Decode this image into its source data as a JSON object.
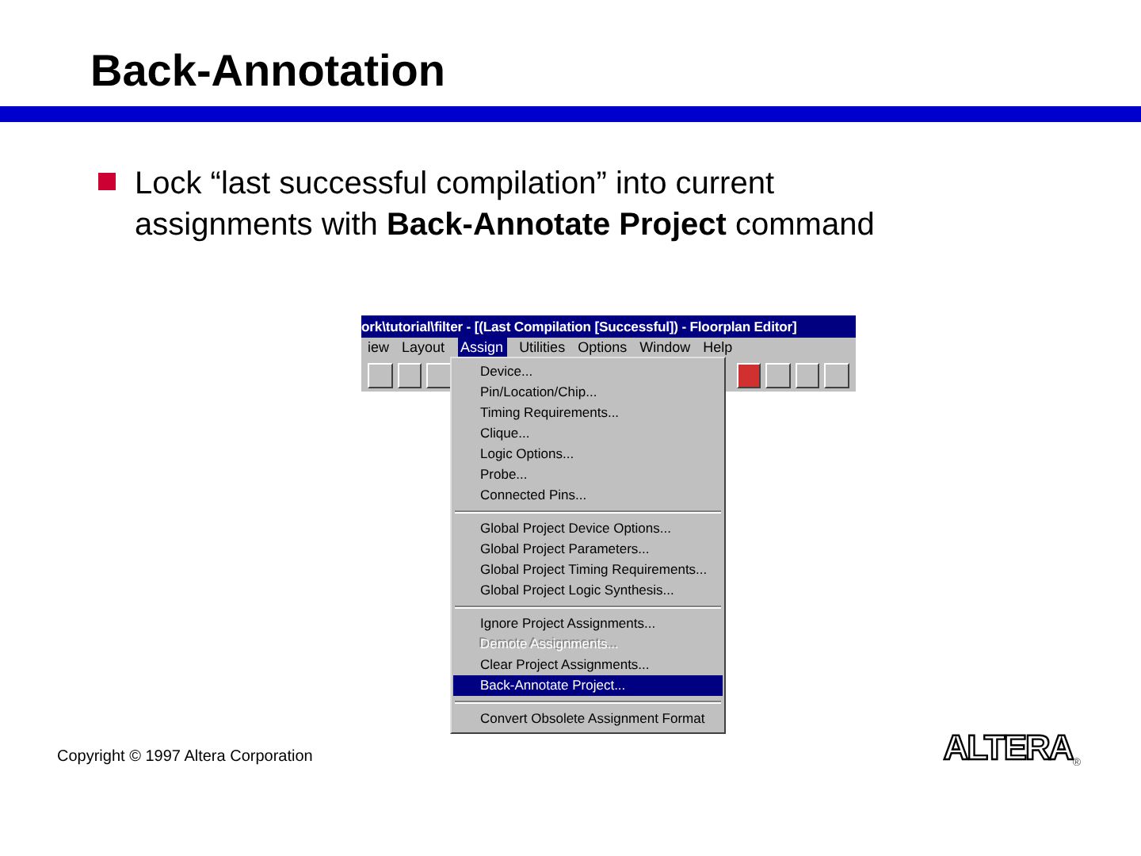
{
  "slide": {
    "title": "Back-Annotation",
    "bullets": [
      {
        "text": "Lock “last successful compilation” into current assignments with **Back-Annotate Project** command"
      }
    ],
    "footer": {
      "copyright": "Copyright © 1997 Altera Corporation",
      "logo": "ALTERA",
      "logo_mark": "®"
    }
  },
  "screenshot": {
    "window_title": "ork\\tutorial\\filter - [(Last Compilation [Successful]) - Floorplan Editor]",
    "menu_bar": [
      {
        "label": "iew",
        "selected": false
      },
      {
        "label": "Layout",
        "selected": false
      },
      {
        "label": "Assign",
        "selected": true
      },
      {
        "label": "Utilities",
        "selected": false
      },
      {
        "label": "Options",
        "selected": false
      },
      {
        "label": "Window",
        "selected": false
      },
      {
        "label": "Help",
        "selected": false
      }
    ],
    "menu_groups": [
      [
        {
          "label": "Device...",
          "selected": false,
          "disabled": false
        },
        {
          "label": "Pin/Location/Chip...",
          "selected": false,
          "disabled": false
        },
        {
          "label": "Timing Requirements...",
          "selected": false,
          "disabled": false
        },
        {
          "label": "Clique...",
          "selected": false,
          "disabled": false
        },
        {
          "label": "Logic Options...",
          "selected": false,
          "disabled": false
        },
        {
          "label": "Probe...",
          "selected": false,
          "disabled": false
        },
        {
          "label": "Connected Pins...",
          "selected": false,
          "disabled": false
        }
      ],
      [
        {
          "label": "Global Project Device Options...",
          "selected": false,
          "disabled": false
        },
        {
          "label": "Global Project Parameters...",
          "selected": false,
          "disabled": false
        },
        {
          "label": "Global Project Timing Requirements...",
          "selected": false,
          "disabled": false
        },
        {
          "label": "Global Project Logic Synthesis...",
          "selected": false,
          "disabled": false
        }
      ],
      [
        {
          "label": "Ignore Project Assignments...",
          "selected": false,
          "disabled": false
        },
        {
          "label": "Demote Assignments...",
          "selected": false,
          "disabled": true
        },
        {
          "label": "Clear Project Assignments...",
          "selected": false,
          "disabled": false
        },
        {
          "label": "Back-Annotate Project...",
          "selected": true,
          "disabled": false
        }
      ],
      [
        {
          "label": "Convert Obsolete Assignment Format",
          "selected": false,
          "disabled": false
        }
      ]
    ]
  }
}
